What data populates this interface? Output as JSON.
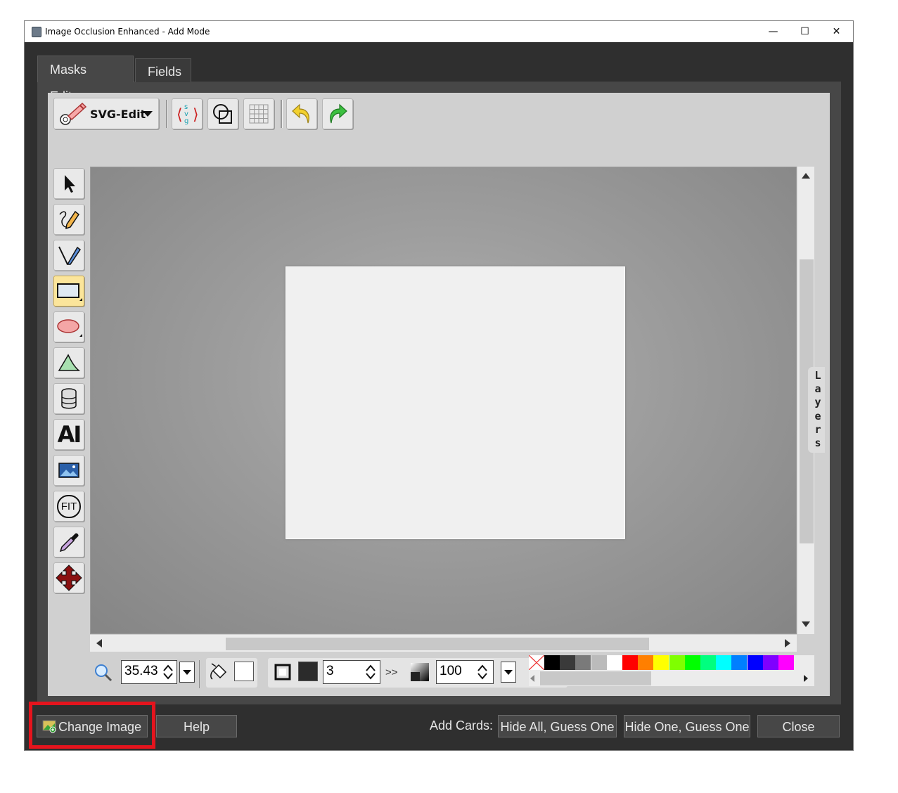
{
  "window": {
    "title": "Image Occlusion Enhanced - Add Mode",
    "controls": {
      "minimize": "—",
      "maximize": "☐",
      "close": "✕"
    }
  },
  "tabs": [
    {
      "label": "Masks Editor",
      "active": true
    },
    {
      "label": "Fields",
      "active": false
    }
  ],
  "toolbar": {
    "menu_label": "SVG-Edit",
    "svg_icon_text": "svg"
  },
  "left_tools": {
    "text_tool_glyph": "AI",
    "fit_label": "FIT"
  },
  "layers_panel": {
    "label": "L\na\ny\ne\nr\ns"
  },
  "bottom_tools": {
    "zoom_value": "35.43",
    "stroke_width": "3",
    "more_glyph": ">>",
    "opacity": "100"
  },
  "palette": [
    "#000000",
    "#3a3a3a",
    "#7a7a7a",
    "#bbbbbb",
    "#ffffff",
    "#ff0000",
    "#ff7f00",
    "#ffff00",
    "#7fff00",
    "#00ff00",
    "#00ff7f",
    "#00ffff",
    "#007fff",
    "#0000ff",
    "#7f00ff",
    "#ff00ff"
  ],
  "footer": {
    "change_image": "Change Image",
    "help": "Help",
    "add_cards_label": "Add Cards:",
    "hide_all": "Hide All, Guess One",
    "hide_one": "Hide One, Guess One",
    "close": "Close"
  }
}
